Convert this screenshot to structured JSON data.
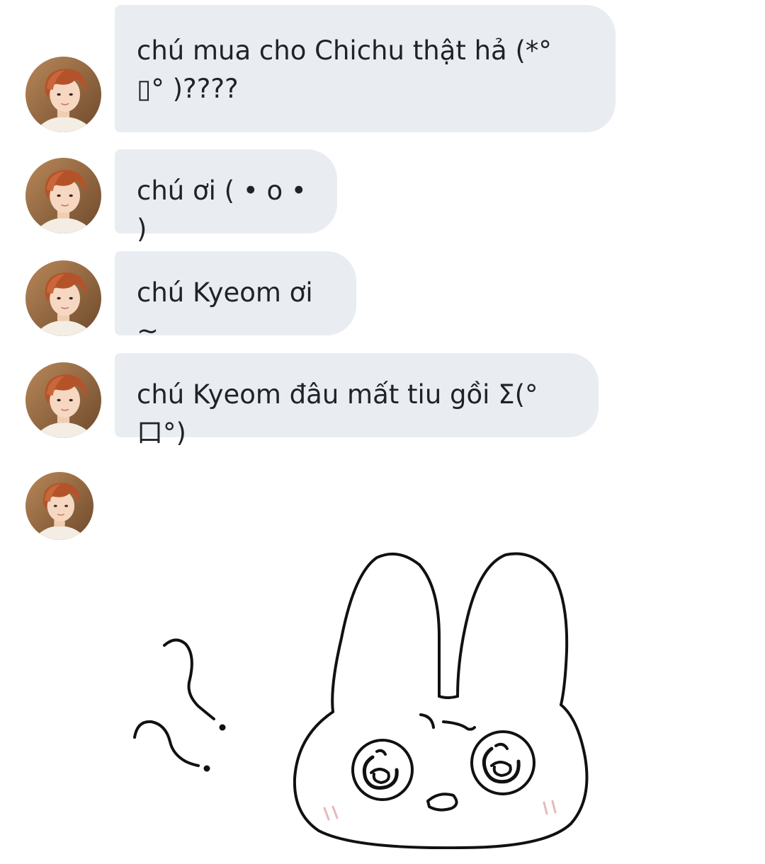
{
  "messages": [
    {
      "text": "chú mua cho Chichu thật hả (*°\n▯° )????"
    },
    {
      "text": "chú ơi ( • o • )"
    },
    {
      "text": "chú Kyeom ơi ~"
    },
    {
      "text": "chú Kyeom đâu mất tiu gồi Σ(°口°)"
    }
  ],
  "sticker": {
    "icon": "bunny-sticker"
  },
  "colors": {
    "bubble_bg": "#e9edf1",
    "text": "#1f2328",
    "background": "#ffffff"
  }
}
